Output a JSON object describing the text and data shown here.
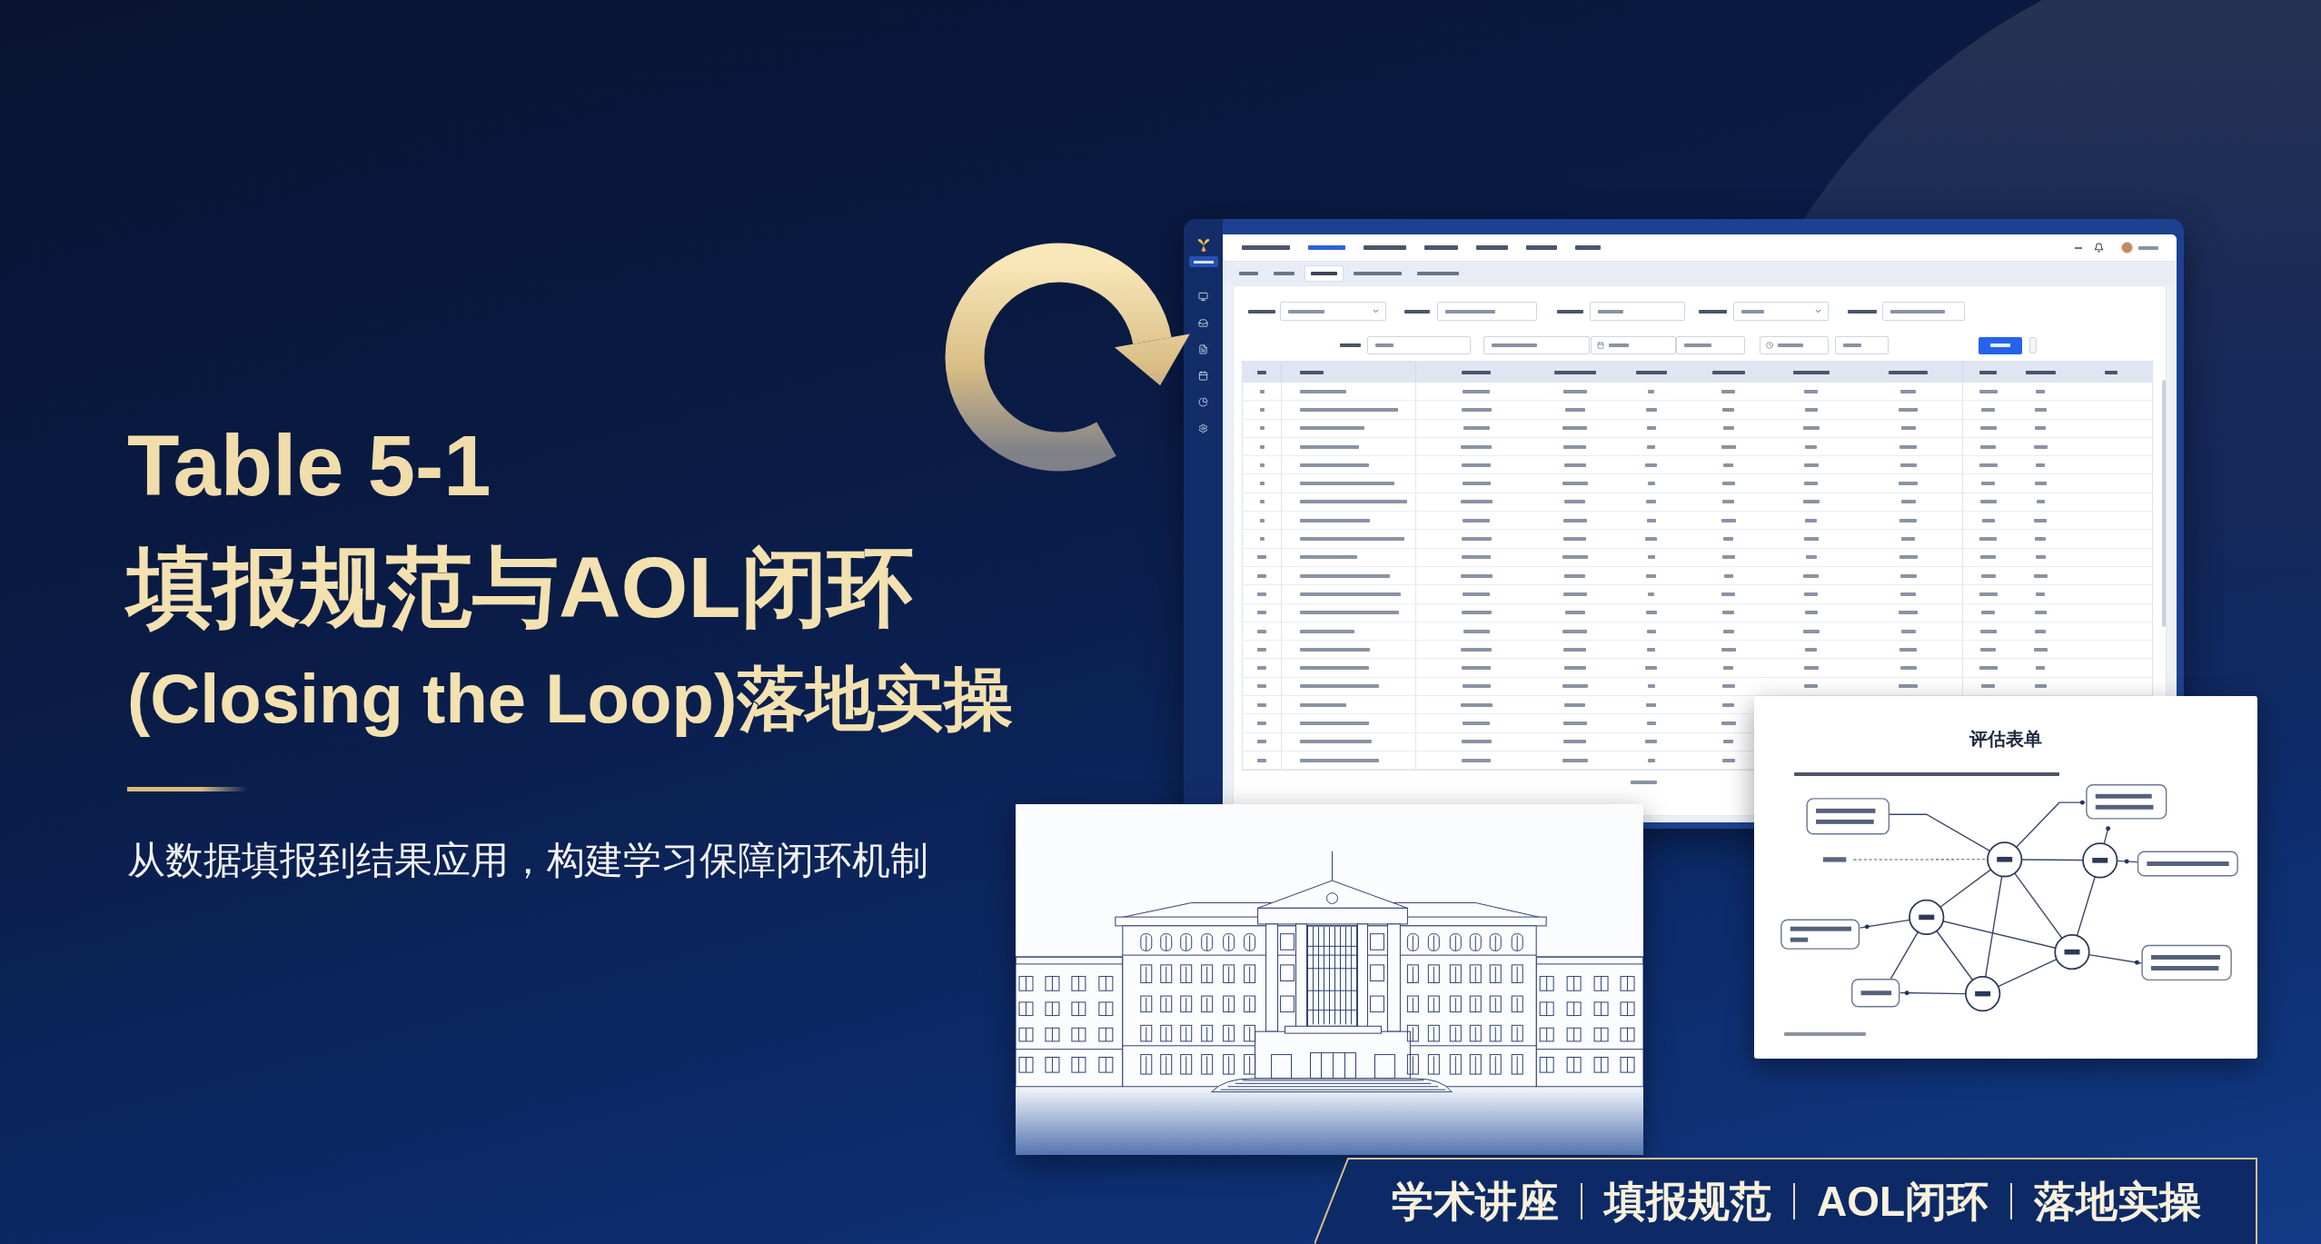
{
  "title": {
    "table_number": "Table 5-1",
    "line_1": "填报规范与AOL闭环",
    "line_2": "(Closing the Loop)落地实操"
  },
  "subtitle": "从数据填报到结果应用，构建学习保障闭环机制",
  "dashboard": {
    "nav_tabs": [
      {
        "selected": false
      },
      {
        "selected": true
      },
      {
        "selected": false
      },
      {
        "selected": false
      },
      {
        "selected": false
      },
      {
        "selected": false
      },
      {
        "selected": false
      }
    ],
    "breadcrumb_tabs": [
      {
        "selected": false
      },
      {
        "selected": false
      },
      {
        "selected": true
      },
      {
        "selected": false
      },
      {
        "selected": false
      }
    ]
  },
  "evaluation_form": {
    "title": "评估表单"
  },
  "tags": [
    "学术讲座",
    "填报规范",
    "AOL闭环",
    "落地实操"
  ]
}
